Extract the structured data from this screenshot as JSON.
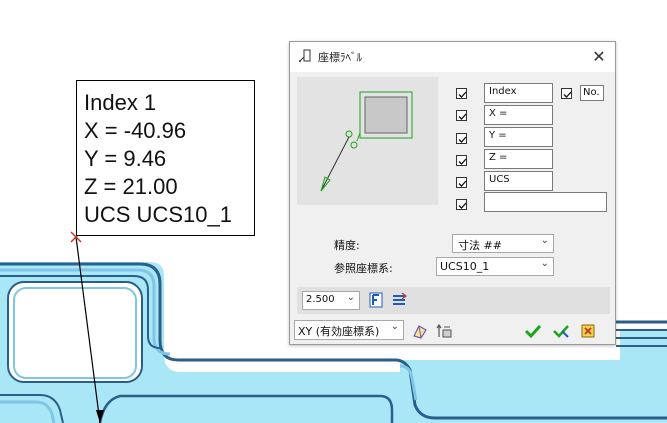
{
  "label": {
    "lines": [
      "Index 1",
      "X = -40.96",
      "Y = 9.46",
      "Z = 21.00",
      "UCS UCS10_1"
    ]
  },
  "dialog": {
    "title": "座標ﾗﾍﾞﾙ",
    "close": "✕",
    "fields": {
      "index": "Index",
      "no_label": "No.",
      "x": "X =",
      "y": "Y =",
      "z": "Z =",
      "ucs": "UCS",
      "extra": ""
    },
    "precision": {
      "label": "精度:",
      "value": "寸法 ##"
    },
    "reference": {
      "label": "参照座標系:",
      "value": "UCS10_1"
    },
    "text_size": "2.500",
    "plane": "XY (有効座標系)"
  },
  "colors": {
    "part_fill": "#a9e7f7",
    "part_outline": "#2a5f8a",
    "accent_green": "#1aa51a",
    "leader_cross": "#c0392b"
  }
}
